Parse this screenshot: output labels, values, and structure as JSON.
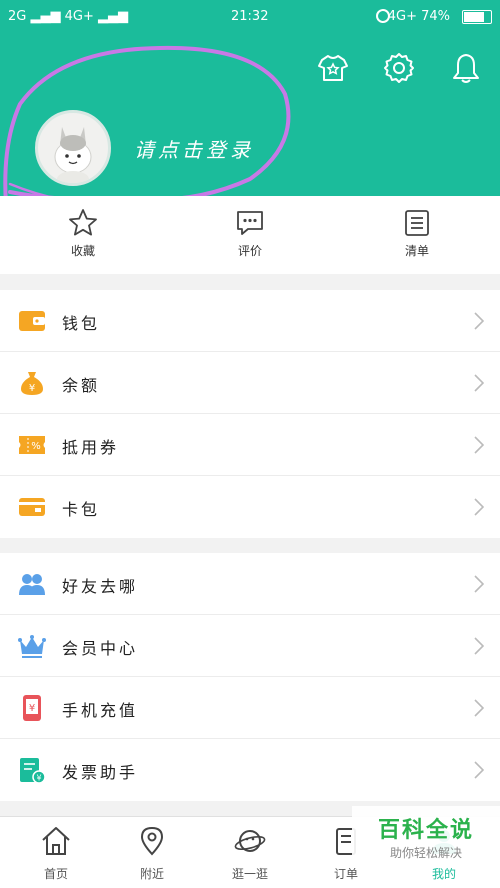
{
  "status_bar": {
    "left": "2G ▂▄▆ 4G+ ▂▄▆",
    "time": "21:32",
    "right": "4G+ 74%"
  },
  "header": {
    "login_text": "请点击登录",
    "bg_color": "#1bbc9b",
    "icons": [
      "shirt-star-icon",
      "gear-icon",
      "bell-icon"
    ]
  },
  "quick_actions": [
    {
      "label": "收藏",
      "icon": "star-icon"
    },
    {
      "label": "评价",
      "icon": "comment-icon"
    },
    {
      "label": "清单",
      "icon": "list-icon"
    }
  ],
  "section1": [
    {
      "label": "钱包",
      "icon": "wallet-icon",
      "color": "#f5a623"
    },
    {
      "label": "余额",
      "icon": "money-bag-icon",
      "color": "#f5a623"
    },
    {
      "label": "抵用券",
      "icon": "coupon-icon",
      "color": "#f5a623"
    },
    {
      "label": "卡包",
      "icon": "card-icon",
      "color": "#f5a623"
    }
  ],
  "section2": [
    {
      "label": "好友去哪",
      "icon": "friends-icon",
      "color": "#5aa0e8"
    },
    {
      "label": "会员中心",
      "icon": "crown-icon",
      "color": "#5aa0e8"
    },
    {
      "label": "手机充值",
      "icon": "phone-topup-icon",
      "color": "#e8545a"
    },
    {
      "label": "发票助手",
      "icon": "invoice-icon",
      "color": "#1bbc9b"
    }
  ],
  "bottom_nav": [
    {
      "label": "首页",
      "icon": "home-icon"
    },
    {
      "label": "附近",
      "icon": "location-icon"
    },
    {
      "label": "逛一逛",
      "icon": "planet-icon"
    },
    {
      "label": "订单",
      "icon": "order-icon"
    },
    {
      "label": "我的",
      "icon": "profile-icon",
      "active": true
    }
  ],
  "watermark": {
    "title": "百科全说",
    "subtitle": "助你轻松解决"
  }
}
